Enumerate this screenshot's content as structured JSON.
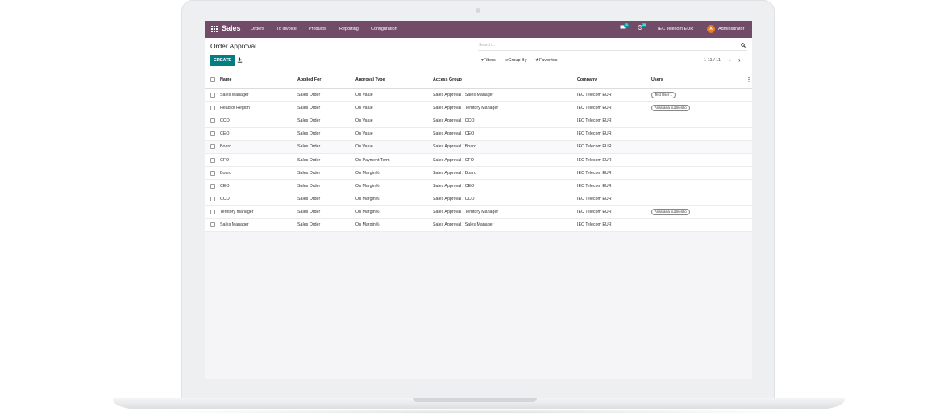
{
  "navbar": {
    "brand": "Sales",
    "menu": [
      "Orders",
      "To Invoice",
      "Products",
      "Reporting",
      "Configuration"
    ],
    "chat_count": "30",
    "activity_count": "38",
    "company": "IEC Telecom EUR",
    "avatar_letter": "A",
    "user": "Administrator"
  },
  "control": {
    "title": "Order Approval",
    "search_placeholder": "Search...",
    "create_label": "CREATE",
    "filters_label": "Filters",
    "groupby_label": "Group By",
    "favorites_label": "Favorites",
    "pager": "1-11 / 11"
  },
  "table": {
    "columns": [
      "Name",
      "Applied For",
      "Approval Type",
      "Access Group",
      "Company",
      "Users"
    ],
    "rows": [
      {
        "name": "Sales Manager",
        "applied": "Sales Order",
        "type": "On Value",
        "group": "Sales Approval / Sales Manager",
        "company": "IEC Telecom EUR",
        "users": "Test User 1"
      },
      {
        "name": "Head of Region",
        "applied": "Sales Order",
        "type": "On Value",
        "group": "Sales Approval / Territory Manager",
        "company": "IEC Telecom EUR",
        "users": "Anastasia kuzmenko"
      },
      {
        "name": "CCO",
        "applied": "Sales Order",
        "type": "On Value",
        "group": "Sales Approval / CCO",
        "company": "IEC Telecom EUR",
        "users": ""
      },
      {
        "name": "CEO",
        "applied": "Sales Order",
        "type": "On Value",
        "group": "Sales Approval / CEO",
        "company": "IEC Telecom EUR",
        "users": ""
      },
      {
        "name": "Board",
        "applied": "Sales Order",
        "type": "On Value",
        "group": "Sales Approval / Board",
        "company": "IEC Telecom EUR",
        "users": ""
      },
      {
        "name": "CFO",
        "applied": "Sales Order",
        "type": "On Payment Term",
        "group": "Sales Approval / CFO",
        "company": "IEC Telecom EUR",
        "users": ""
      },
      {
        "name": "Board",
        "applied": "Sales Order",
        "type": "On Margin%",
        "group": "Sales Approval / Board",
        "company": "IEC Telecom EUR",
        "users": ""
      },
      {
        "name": "CEO",
        "applied": "Sales Order",
        "type": "On Margin%",
        "group": "Sales Approval / CEO",
        "company": "IEC Telecom EUR",
        "users": ""
      },
      {
        "name": "CCO",
        "applied": "Sales Order",
        "type": "On Margin%",
        "group": "Sales Approval / CCO",
        "company": "IEC Telecom EUR",
        "users": ""
      },
      {
        "name": "Territory manager",
        "applied": "Sales Order",
        "type": "On Margin%",
        "group": "Sales Approval / Territory Manager",
        "company": "IEC Telecom EUR",
        "users": "Anastasia kuzmenko"
      },
      {
        "name": "Sales Manager",
        "applied": "Sales Order",
        "type": "On Margin%",
        "group": "Sales Approval / Sales Manager",
        "company": "IEC Telecom EUR",
        "users": ""
      }
    ]
  },
  "colors": {
    "navbar": "#714b67",
    "primary": "#017e84",
    "avatar": "#e67e22"
  }
}
